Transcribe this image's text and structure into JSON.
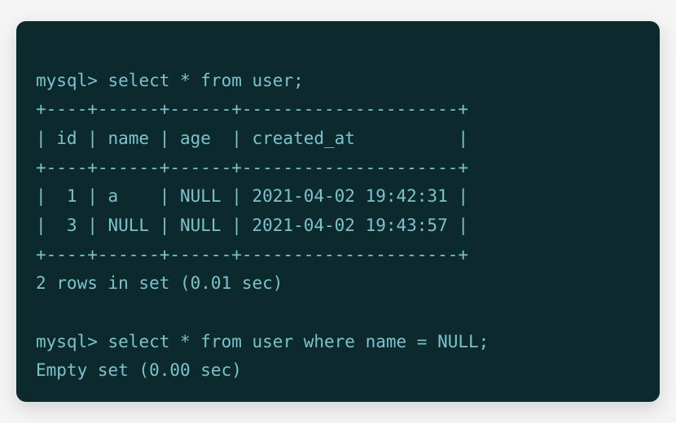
{
  "terminal": {
    "prompt": "mysql>",
    "query1": "select * from user;",
    "divider_top": "+----+------+------+---------------------+",
    "header_row": "| id | name | age  | created_at          |",
    "divider_mid": "+----+------+------+---------------------+",
    "row1": "|  1 | a    | NULL | 2021-04-02 19:42:31 |",
    "row2": "|  3 | NULL | NULL | 2021-04-02 19:43:57 |",
    "divider_bot": "+----+------+------+---------------------+",
    "result1": "2 rows in set (0.01 sec)",
    "blank": "",
    "query2": "select * from user where name = NULL;",
    "result2": "Empty set (0.00 sec)"
  }
}
